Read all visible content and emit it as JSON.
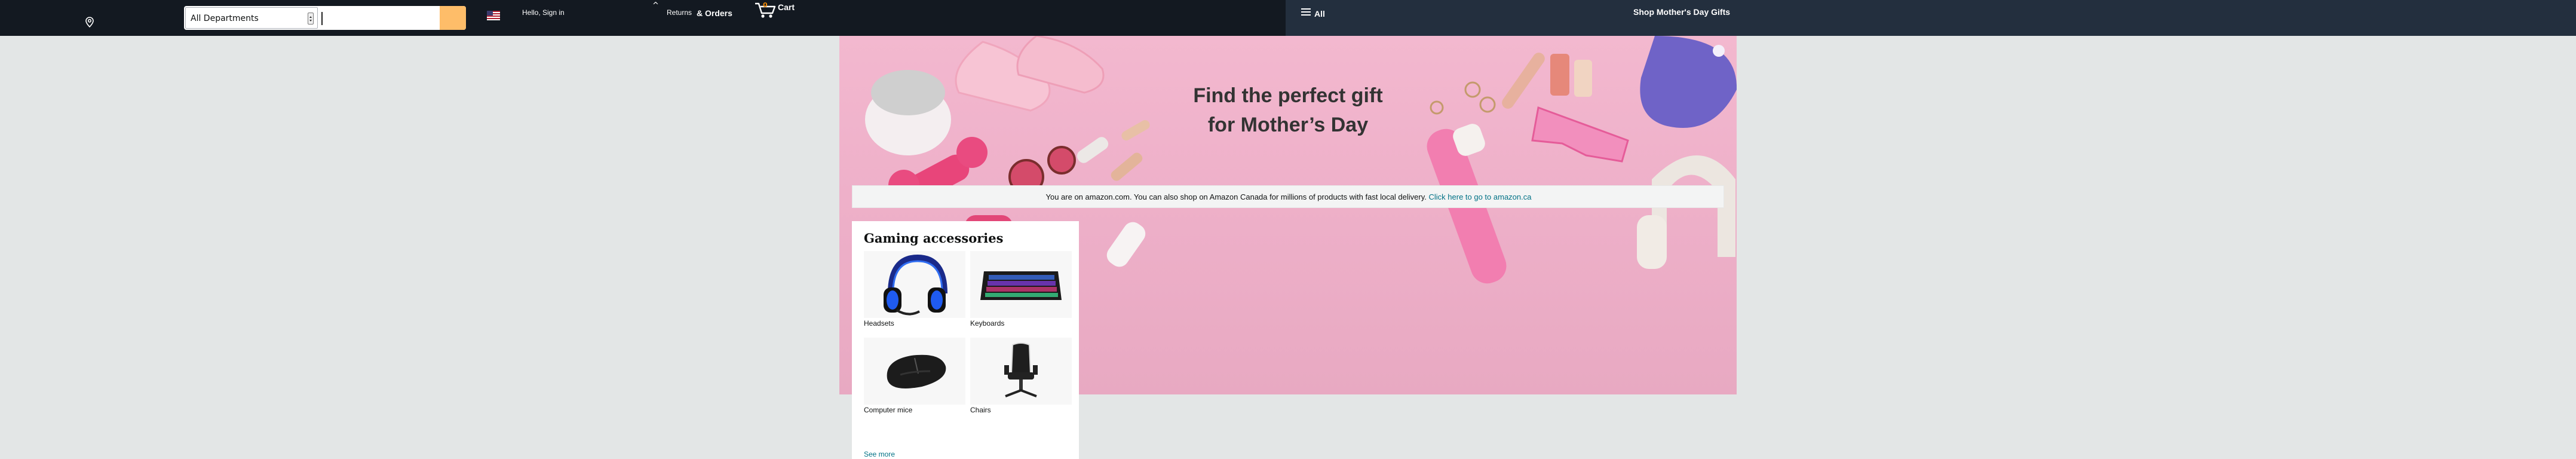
{
  "nav": {
    "search": {
      "department": "All Departments",
      "placeholder": ""
    },
    "signin": "Hello, Sign in",
    "returns": "Returns",
    "orders": "& Orders",
    "cart_count": "0",
    "cart_label": "Cart",
    "all_label": "All",
    "promo": "Shop Mother's Day Gifts"
  },
  "hero": {
    "title_line1": "Find the perfect gift",
    "title_line2": "for Mother’s Day"
  },
  "canada_banner": {
    "text": "You are on amazon.com. You can also shop on Amazon Canada for millions of products with fast local delivery.",
    "link": "Click here to go to amazon.ca"
  },
  "gaming_card": {
    "title": "Gaming accessories",
    "items": [
      {
        "label": "Headsets"
      },
      {
        "label": "Keyboards"
      },
      {
        "label": "Computer mice"
      },
      {
        "label": "Chairs"
      }
    ],
    "see_more": "See more"
  },
  "colors": {
    "nav_bg": "#131921",
    "subnav_bg": "#232f3e",
    "search_button": "#febd69",
    "link": "#007185",
    "page_bg": "#e3e6e6",
    "hero_bg": "#efb2ca"
  },
  "icons": [
    "location-pin-icon",
    "us-flag-icon",
    "search-icon",
    "cart-icon",
    "hamburger-menu-icon",
    "headset-icon",
    "keyboard-icon",
    "mouse-icon",
    "chair-icon"
  ]
}
